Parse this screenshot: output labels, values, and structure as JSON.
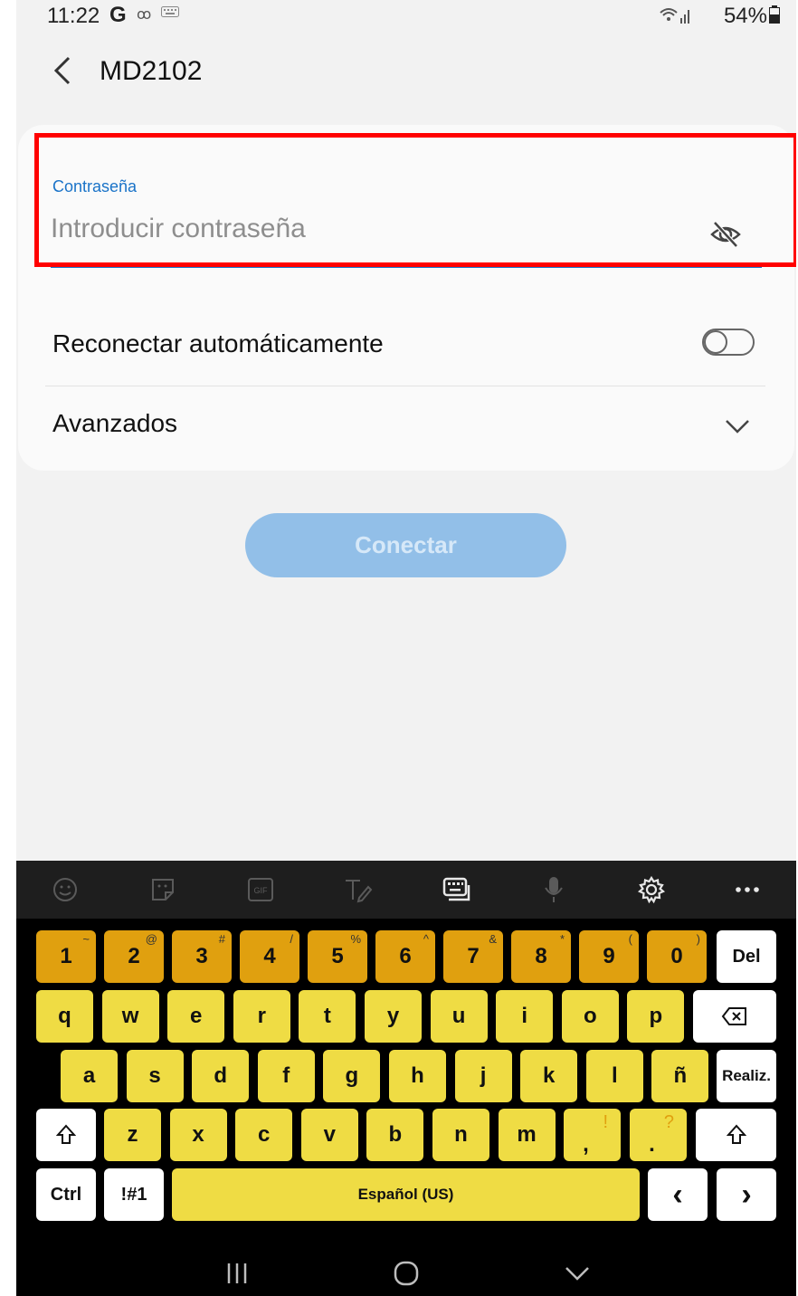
{
  "status_bar": {
    "time": "11:22",
    "g_icon": "G",
    "voicemail_icon": "ꝏ",
    "battery_percent": "54%"
  },
  "header": {
    "title": "MD2102",
    "back_icon": "chevron-left-icon"
  },
  "password": {
    "label": "Contraseña",
    "placeholder": "Introducir contraseña",
    "value": "",
    "visibility_icon": "eye-off-icon",
    "highlight_color": "#ff0000"
  },
  "auto_reconnect": {
    "label": "Reconectar automáticamente",
    "enabled": false
  },
  "advanced": {
    "label": "Avanzados",
    "icon": "chevron-down-icon"
  },
  "connect_button": {
    "label": "Conectar",
    "enabled": false,
    "color": "#92bfe8"
  },
  "keyboard": {
    "toolbar_icons": [
      "emoji-icon",
      "sticker-icon",
      "gif-icon",
      "handwriting-icon",
      "keyboard-icon",
      "microphone-icon",
      "gear-icon",
      "more-icon"
    ],
    "gif_label": "GIF",
    "row_numbers": [
      {
        "main": "1",
        "sup": "~"
      },
      {
        "main": "2",
        "sup": "@"
      },
      {
        "main": "3",
        "sup": "#"
      },
      {
        "main": "4",
        "sup": "/"
      },
      {
        "main": "5",
        "sup": "%"
      },
      {
        "main": "6",
        "sup": "^"
      },
      {
        "main": "7",
        "sup": "&"
      },
      {
        "main": "8",
        "sup": "*"
      },
      {
        "main": "9",
        "sup": "("
      },
      {
        "main": "0",
        "sup": ")"
      }
    ],
    "del_label": "Del",
    "row_q": [
      "q",
      "w",
      "e",
      "r",
      "t",
      "y",
      "u",
      "i",
      "o",
      "p"
    ],
    "row_a": [
      "a",
      "s",
      "d",
      "f",
      "g",
      "h",
      "j",
      "k",
      "l",
      "ñ"
    ],
    "done_label": "Realiz.",
    "row_z": [
      "z",
      "x",
      "c",
      "v",
      "b",
      "n",
      "m"
    ],
    "comma_key": {
      "main": ",",
      "sup": "!"
    },
    "period_key": {
      "main": ".",
      "sup": "?"
    },
    "ctrl_label": "Ctrl",
    "symbols_label": "!#1",
    "space_label": "Español (US)",
    "left_arrow": "‹",
    "right_arrow": "›",
    "key_color_numbers": "#e0a00f",
    "key_color_letters": "#efdc44"
  },
  "nav_bar": {
    "recents_icon": "recents-icon",
    "home_icon": "home-icon",
    "hide_keyboard_icon": "chevron-down-icon"
  }
}
